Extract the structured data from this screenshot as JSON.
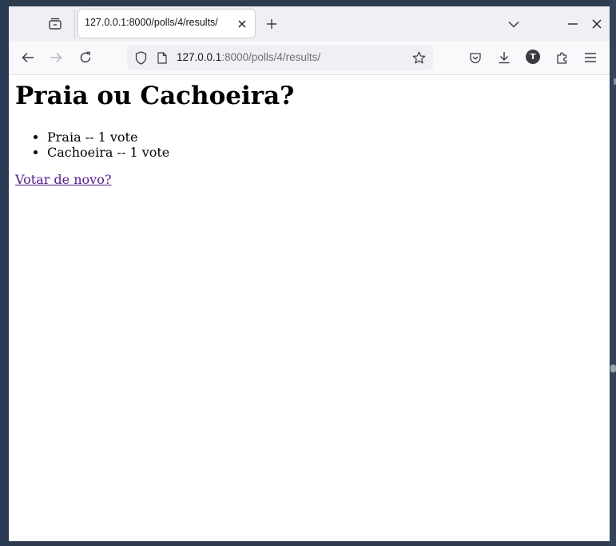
{
  "browser": {
    "tab": {
      "title": "127.0.0.1:8000/polls/4/results/"
    },
    "url": {
      "host": "127.0.0.1",
      "rest": ":8000/polls/4/results/"
    },
    "account_initial": "T",
    "icons": {
      "tab_side": "folder-tab-icon",
      "tab_close": "close-icon",
      "new_tab": "plus-icon",
      "list_tabs": "chevron-down-icon",
      "minimize": "minimize-icon",
      "close_window": "close-window-icon",
      "back": "back-arrow-icon",
      "forward": "forward-arrow-icon",
      "reload": "reload-icon",
      "shield": "shield-icon",
      "page": "page-icon",
      "bookmark": "star-icon",
      "pocket": "pocket-icon",
      "downloads": "download-icon",
      "extensions": "puzzle-icon",
      "menu": "hamburger-menu-icon"
    }
  },
  "page": {
    "question": "Praia ou Cachoeira?",
    "choices": [
      "Praia -- 1 vote",
      "Cachoeira -- 1 vote"
    ],
    "vote_again_link": "Votar de novo?",
    "colors": {
      "link_visited": "#551a8b",
      "text": "#000000"
    }
  }
}
